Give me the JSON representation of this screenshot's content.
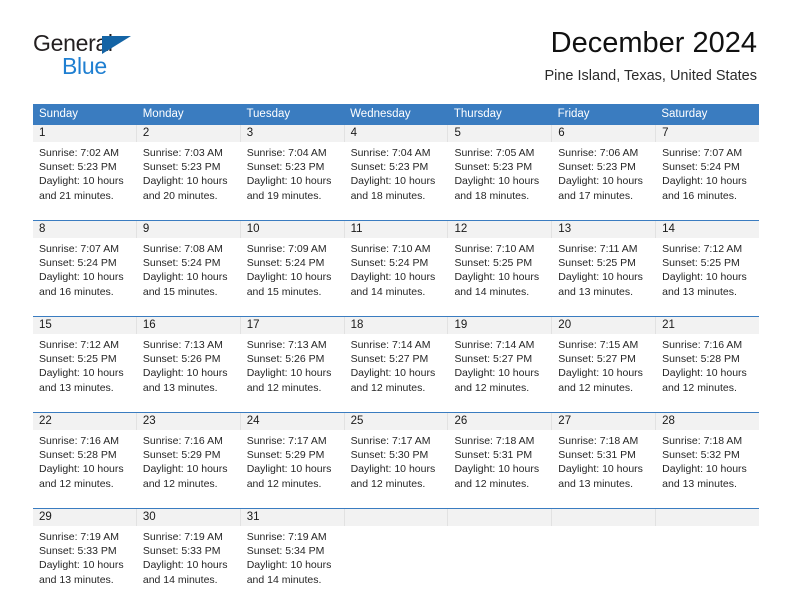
{
  "brand": {
    "name_part1": "General",
    "name_part2": "Blue",
    "accent_color": "#1f7fd1",
    "triangle_color": "#1464a5"
  },
  "header": {
    "title": "December 2024",
    "subtitle": "Pine Island, Texas, United States"
  },
  "theme": {
    "header_row_color": "#3a7cc0",
    "date_band_color": "#f2f2f2",
    "text_color": "#262626"
  },
  "weekdays": [
    "Sunday",
    "Monday",
    "Tuesday",
    "Wednesday",
    "Thursday",
    "Friday",
    "Saturday"
  ],
  "weeks": [
    {
      "days": [
        {
          "date": "1",
          "sunrise": "Sunrise: 7:02 AM",
          "sunset": "Sunset: 5:23 PM",
          "daylight1": "Daylight: 10 hours",
          "daylight2": "and 21 minutes."
        },
        {
          "date": "2",
          "sunrise": "Sunrise: 7:03 AM",
          "sunset": "Sunset: 5:23 PM",
          "daylight1": "Daylight: 10 hours",
          "daylight2": "and 20 minutes."
        },
        {
          "date": "3",
          "sunrise": "Sunrise: 7:04 AM",
          "sunset": "Sunset: 5:23 PM",
          "daylight1": "Daylight: 10 hours",
          "daylight2": "and 19 minutes."
        },
        {
          "date": "4",
          "sunrise": "Sunrise: 7:04 AM",
          "sunset": "Sunset: 5:23 PM",
          "daylight1": "Daylight: 10 hours",
          "daylight2": "and 18 minutes."
        },
        {
          "date": "5",
          "sunrise": "Sunrise: 7:05 AM",
          "sunset": "Sunset: 5:23 PM",
          "daylight1": "Daylight: 10 hours",
          "daylight2": "and 18 minutes."
        },
        {
          "date": "6",
          "sunrise": "Sunrise: 7:06 AM",
          "sunset": "Sunset: 5:23 PM",
          "daylight1": "Daylight: 10 hours",
          "daylight2": "and 17 minutes."
        },
        {
          "date": "7",
          "sunrise": "Sunrise: 7:07 AM",
          "sunset": "Sunset: 5:24 PM",
          "daylight1": "Daylight: 10 hours",
          "daylight2": "and 16 minutes."
        }
      ]
    },
    {
      "days": [
        {
          "date": "8",
          "sunrise": "Sunrise: 7:07 AM",
          "sunset": "Sunset: 5:24 PM",
          "daylight1": "Daylight: 10 hours",
          "daylight2": "and 16 minutes."
        },
        {
          "date": "9",
          "sunrise": "Sunrise: 7:08 AM",
          "sunset": "Sunset: 5:24 PM",
          "daylight1": "Daylight: 10 hours",
          "daylight2": "and 15 minutes."
        },
        {
          "date": "10",
          "sunrise": "Sunrise: 7:09 AM",
          "sunset": "Sunset: 5:24 PM",
          "daylight1": "Daylight: 10 hours",
          "daylight2": "and 15 minutes."
        },
        {
          "date": "11",
          "sunrise": "Sunrise: 7:10 AM",
          "sunset": "Sunset: 5:24 PM",
          "daylight1": "Daylight: 10 hours",
          "daylight2": "and 14 minutes."
        },
        {
          "date": "12",
          "sunrise": "Sunrise: 7:10 AM",
          "sunset": "Sunset: 5:25 PM",
          "daylight1": "Daylight: 10 hours",
          "daylight2": "and 14 minutes."
        },
        {
          "date": "13",
          "sunrise": "Sunrise: 7:11 AM",
          "sunset": "Sunset: 5:25 PM",
          "daylight1": "Daylight: 10 hours",
          "daylight2": "and 13 minutes."
        },
        {
          "date": "14",
          "sunrise": "Sunrise: 7:12 AM",
          "sunset": "Sunset: 5:25 PM",
          "daylight1": "Daylight: 10 hours",
          "daylight2": "and 13 minutes."
        }
      ]
    },
    {
      "days": [
        {
          "date": "15",
          "sunrise": "Sunrise: 7:12 AM",
          "sunset": "Sunset: 5:25 PM",
          "daylight1": "Daylight: 10 hours",
          "daylight2": "and 13 minutes."
        },
        {
          "date": "16",
          "sunrise": "Sunrise: 7:13 AM",
          "sunset": "Sunset: 5:26 PM",
          "daylight1": "Daylight: 10 hours",
          "daylight2": "and 13 minutes."
        },
        {
          "date": "17",
          "sunrise": "Sunrise: 7:13 AM",
          "sunset": "Sunset: 5:26 PM",
          "daylight1": "Daylight: 10 hours",
          "daylight2": "and 12 minutes."
        },
        {
          "date": "18",
          "sunrise": "Sunrise: 7:14 AM",
          "sunset": "Sunset: 5:27 PM",
          "daylight1": "Daylight: 10 hours",
          "daylight2": "and 12 minutes."
        },
        {
          "date": "19",
          "sunrise": "Sunrise: 7:14 AM",
          "sunset": "Sunset: 5:27 PM",
          "daylight1": "Daylight: 10 hours",
          "daylight2": "and 12 minutes."
        },
        {
          "date": "20",
          "sunrise": "Sunrise: 7:15 AM",
          "sunset": "Sunset: 5:27 PM",
          "daylight1": "Daylight: 10 hours",
          "daylight2": "and 12 minutes."
        },
        {
          "date": "21",
          "sunrise": "Sunrise: 7:16 AM",
          "sunset": "Sunset: 5:28 PM",
          "daylight1": "Daylight: 10 hours",
          "daylight2": "and 12 minutes."
        }
      ]
    },
    {
      "days": [
        {
          "date": "22",
          "sunrise": "Sunrise: 7:16 AM",
          "sunset": "Sunset: 5:28 PM",
          "daylight1": "Daylight: 10 hours",
          "daylight2": "and 12 minutes."
        },
        {
          "date": "23",
          "sunrise": "Sunrise: 7:16 AM",
          "sunset": "Sunset: 5:29 PM",
          "daylight1": "Daylight: 10 hours",
          "daylight2": "and 12 minutes."
        },
        {
          "date": "24",
          "sunrise": "Sunrise: 7:17 AM",
          "sunset": "Sunset: 5:29 PM",
          "daylight1": "Daylight: 10 hours",
          "daylight2": "and 12 minutes."
        },
        {
          "date": "25",
          "sunrise": "Sunrise: 7:17 AM",
          "sunset": "Sunset: 5:30 PM",
          "daylight1": "Daylight: 10 hours",
          "daylight2": "and 12 minutes."
        },
        {
          "date": "26",
          "sunrise": "Sunrise: 7:18 AM",
          "sunset": "Sunset: 5:31 PM",
          "daylight1": "Daylight: 10 hours",
          "daylight2": "and 12 minutes."
        },
        {
          "date": "27",
          "sunrise": "Sunrise: 7:18 AM",
          "sunset": "Sunset: 5:31 PM",
          "daylight1": "Daylight: 10 hours",
          "daylight2": "and 13 minutes."
        },
        {
          "date": "28",
          "sunrise": "Sunrise: 7:18 AM",
          "sunset": "Sunset: 5:32 PM",
          "daylight1": "Daylight: 10 hours",
          "daylight2": "and 13 minutes."
        }
      ]
    },
    {
      "days": [
        {
          "date": "29",
          "sunrise": "Sunrise: 7:19 AM",
          "sunset": "Sunset: 5:33 PM",
          "daylight1": "Daylight: 10 hours",
          "daylight2": "and 13 minutes."
        },
        {
          "date": "30",
          "sunrise": "Sunrise: 7:19 AM",
          "sunset": "Sunset: 5:33 PM",
          "daylight1": "Daylight: 10 hours",
          "daylight2": "and 14 minutes."
        },
        {
          "date": "31",
          "sunrise": "Sunrise: 7:19 AM",
          "sunset": "Sunset: 5:34 PM",
          "daylight1": "Daylight: 10 hours",
          "daylight2": "and 14 minutes."
        },
        {
          "date": "",
          "sunrise": "",
          "sunset": "",
          "daylight1": "",
          "daylight2": ""
        },
        {
          "date": "",
          "sunrise": "",
          "sunset": "",
          "daylight1": "",
          "daylight2": ""
        },
        {
          "date": "",
          "sunrise": "",
          "sunset": "",
          "daylight1": "",
          "daylight2": ""
        },
        {
          "date": "",
          "sunrise": "",
          "sunset": "",
          "daylight1": "",
          "daylight2": ""
        }
      ]
    }
  ]
}
